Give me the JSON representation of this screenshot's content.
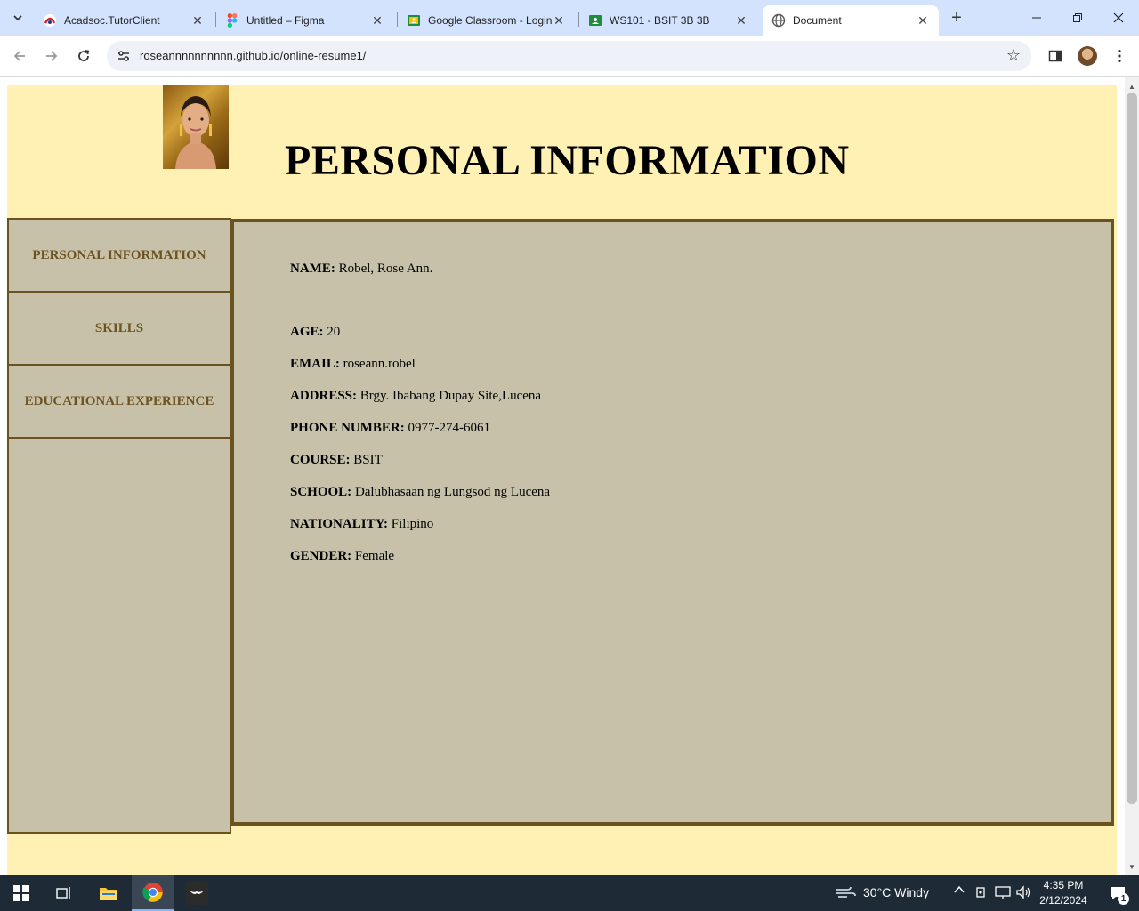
{
  "browser": {
    "tabs": [
      {
        "title": "Acadsoc.TutorClient",
        "icon": "acadsoc-icon"
      },
      {
        "title": "Untitled – Figma",
        "icon": "figma-icon"
      },
      {
        "title": "Google Classroom - Login",
        "icon": "classroom-icon"
      },
      {
        "title": "WS101 - BSIT 3B 3B",
        "icon": "classroom-icon"
      },
      {
        "title": "Document",
        "icon": "globe-icon",
        "active": true
      }
    ],
    "url": "roseannnnnnnnnn.github.io/online-resume1/"
  },
  "page": {
    "heading": "PERSONAL INFORMATION",
    "nav": [
      "PERSONAL INFORMATION",
      "SKILLS",
      "EDUCATIONAL EXPERIENCE"
    ],
    "info": [
      {
        "label": "NAME:",
        "value": " Robel, Rose Ann."
      },
      {
        "label": "AGE:",
        "value": " 20"
      },
      {
        "label": "EMAIL:",
        "value": " roseann.robel"
      },
      {
        "label": "ADDRESS:",
        "value": " Brgy. Ibabang Dupay Site,Lucena"
      },
      {
        "label": "PHONE NUMBER:",
        "value": " 0977-274-6061"
      },
      {
        "label": "COURSE:",
        "value": " BSIT"
      },
      {
        "label": "SCHOOL:",
        "value": " Dalubhasaan ng Lungsod ng Lucena"
      },
      {
        "label": "NATIONALITY:",
        "value": " Filipino"
      },
      {
        "label": "GENDER:",
        "value": " Female"
      }
    ]
  },
  "taskbar": {
    "weather": "30°C  Windy",
    "time": "4:35 PM",
    "date": "2/12/2024",
    "notifications": "1"
  },
  "colors": {
    "page_bg": "#fff0b3",
    "panel_bg": "#c8c1aa",
    "border": "#6b5320"
  }
}
